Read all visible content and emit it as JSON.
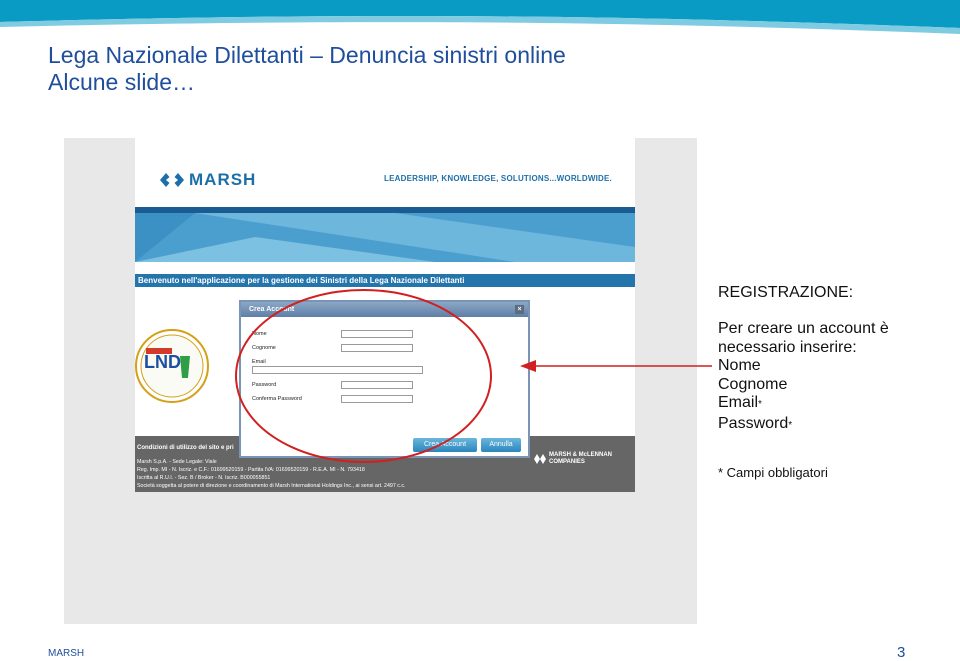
{
  "slide": {
    "title_line1": "Lega Nazionale Dilettanti – Denuncia sinistri online",
    "title_line2": "Alcune slide…",
    "footer_brand": "MARSH",
    "page_number": "3"
  },
  "screenshot": {
    "logo_text": "MARSH",
    "tagline": "LEADERSHIP, KNOWLEDGE, SOLUTIONS...WORLDWIDE.",
    "welcome": "Benvenuto nell'applicazione per la gestione dei Sinistri della Lega Nazionale Dilettanti",
    "dialog": {
      "title": "Crea Account",
      "close_symbol": "×",
      "fields": [
        "Nome",
        "Cognome",
        "Email",
        "Password",
        "Conferma Password"
      ],
      "create_button": "Crea Account",
      "cancel_button": "Annulla"
    },
    "footer": {
      "heading": "Condizioni di utilizzo del sito e pri",
      "lines": [
        "Marsh S.p.A. - Sede Legale: Viale",
        "Reg. Imp. MI - N. Iscriz. e C.F.: 01699520159 - Partita IVA: 01699520159 - R.E.A. MI - N. 793418",
        "Iscritta al R.U.I. - Sez. B / Broker - N. Iscriz. B000055851",
        "Società soggetta al potere di direzione e coordinamento di Marsh International Holdings Inc., ai sensi art. 2497 c.c."
      ],
      "partner_line1": "MARSH & McLENNAN",
      "partner_line2": "COMPANIES"
    }
  },
  "registration": {
    "title": "REGISTRAZIONE:",
    "line1": "Per creare un account è",
    "line2": "necessario inserire:",
    "field_nome": "Nome",
    "field_cognome": "Cognome",
    "field_email": "Email",
    "field_password": "Password",
    "asterisk": "*",
    "required_note": "* Campi obbligatori"
  },
  "colors": {
    "title_blue": "#1f4e9c",
    "marsh_blue": "#1c6fa8",
    "annotation_red": "#d21f1f",
    "footer_gray": "#666666"
  }
}
